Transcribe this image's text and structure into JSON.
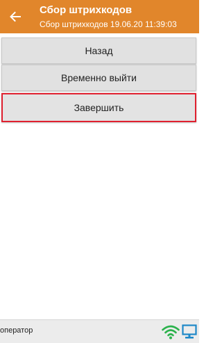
{
  "header": {
    "title": "Сбор штрихкодов",
    "subtitle": "Сбор штрихкодов 19.06.20 11:39:03",
    "back_icon": "arrow-left-icon",
    "background_color": "#e1862b"
  },
  "menu": {
    "back_label": "Назад",
    "exit_label": "Временно выйти",
    "finish_label": "Завершить",
    "highlight_color": "#e0202f"
  },
  "statusbar": {
    "user_label": "оператор",
    "wifi_icon": "wifi-icon",
    "monitor_icon": "monitor-icon",
    "wifi_color": "#2bb24c",
    "monitor_color": "#1e88c8"
  }
}
